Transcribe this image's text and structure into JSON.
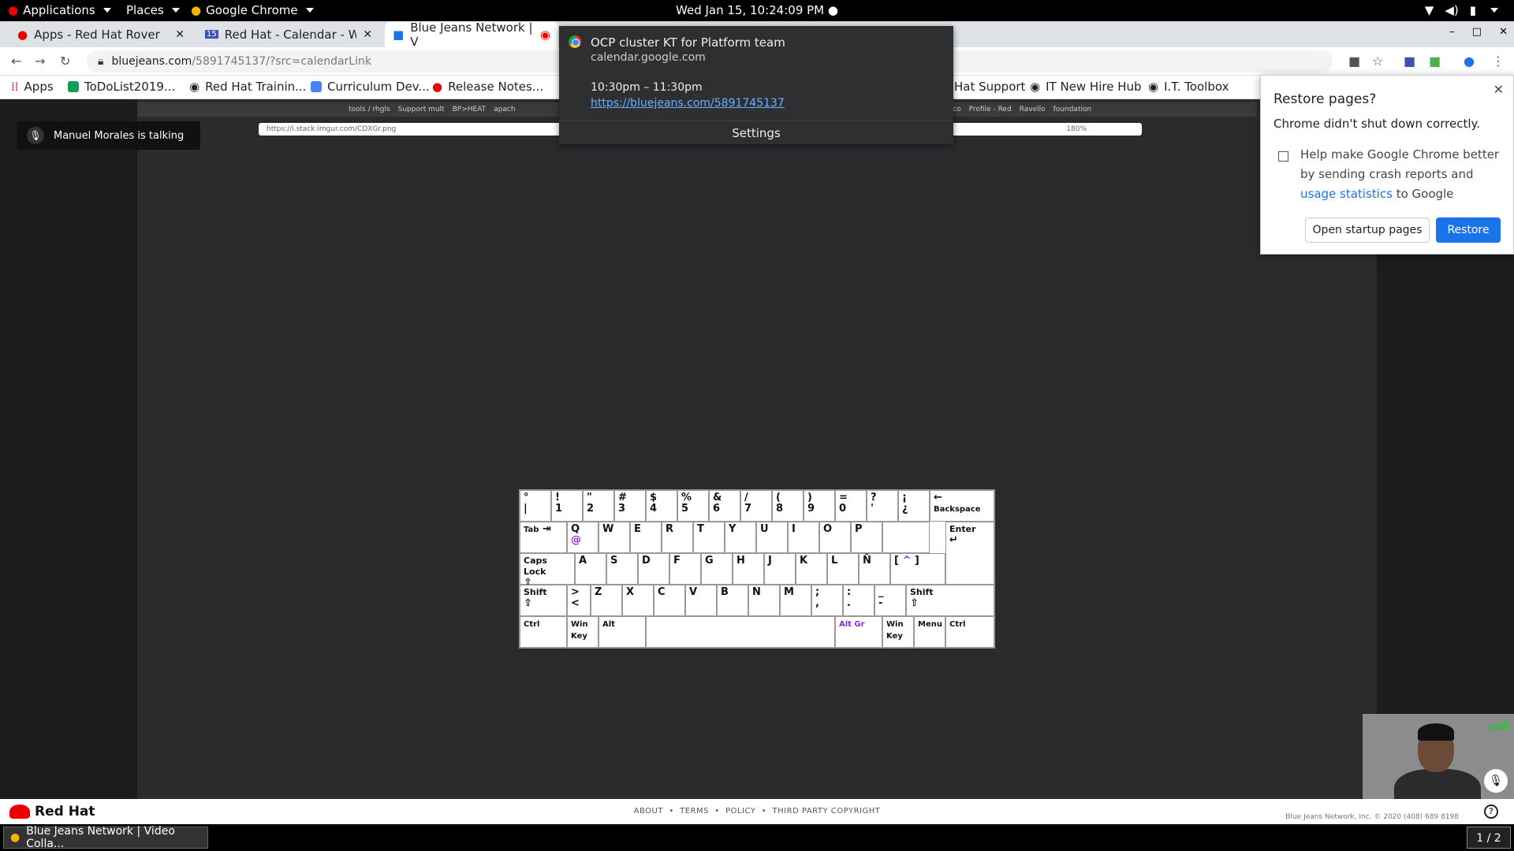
{
  "topbar": {
    "applications": "Applications",
    "places": "Places",
    "chrome": "Google Chrome",
    "clock": "Wed Jan 15, 10:24:09 PM"
  },
  "tabs": [
    {
      "label": "Apps - Red Hat Rover"
    },
    {
      "label": "Red Hat - Calendar - Week"
    },
    {
      "label": "Blue Jeans Network | V"
    }
  ],
  "address": {
    "host": "bluejeans.com",
    "path": "/5891745137/?src=calendarLink"
  },
  "bookmarks": [
    "Apps",
    "ToDoList2019...",
    "Red Hat Trainin...",
    "Curriculum Dev...",
    "Release Notes...",
    "Hat Support",
    "IT New Hire Hub",
    "I.T. Toolbox"
  ],
  "inner": {
    "tabs": [
      "tools / rhgls",
      "Support mult",
      "BP>HEAT",
      "apach",
      "Providing co",
      "Profile - Red",
      "Ravello",
      "foundation"
    ],
    "url": "https://i.stack.imgur.com/CDXGr.png",
    "zoom": "180%"
  },
  "talking": "Manuel Morales is talking",
  "notification": {
    "title": "OCP cluster KT for Platform team",
    "source": "calendar.google.com",
    "time": "10:30pm – 11:30pm",
    "link": "https://bluejeans.com/5891745137",
    "settings": "Settings"
  },
  "restore": {
    "title": "Restore pages?",
    "message": "Chrome didn't shut down correctly.",
    "help_pre": "Help make Google Chrome better by sending crash reports and",
    "help_link": "usage statistics",
    "help_post": "to Google",
    "open_btn": "Open startup pages",
    "restore_btn": "Restore"
  },
  "footer": {
    "brand": "Red Hat",
    "links": [
      "ABOUT",
      "TERMS",
      "POLICY",
      "THIRD PARTY COPYRIGHT"
    ],
    "legal": "Blue Jeans Network, Inc. © 2020     (408) 689 8198"
  },
  "taskbar": {
    "window": "Blue Jeans Network | Video Colla...",
    "pager": "1 / 2"
  },
  "keyboard": {
    "row1": [
      [
        "°",
        "|"
      ],
      [
        "!",
        "1"
      ],
      [
        "\"",
        "2"
      ],
      [
        "#",
        "3"
      ],
      [
        "$",
        "4"
      ],
      [
        "%",
        "5"
      ],
      [
        "&",
        "6"
      ],
      [
        "/",
        "7"
      ],
      [
        "(",
        "8"
      ],
      [
        ")",
        "9"
      ],
      [
        "=",
        "0"
      ],
      [
        "?",
        "'"
      ],
      [
        "¡",
        "¿"
      ]
    ],
    "backspace": "Backspace",
    "tab": "Tab",
    "row2": [
      "Q",
      "W",
      "E",
      "R",
      "T",
      "Y",
      "U",
      "I",
      "O",
      "P"
    ],
    "at": "@",
    "enter": "Enter",
    "caps": "Caps Lock",
    "row3": [
      "A",
      "S",
      "D",
      "F",
      "G",
      "H",
      "J",
      "K",
      "L",
      "Ñ"
    ],
    "shift": "Shift",
    "row4": [
      "Z",
      "X",
      "C",
      "V",
      "B",
      "N",
      "M"
    ],
    "bottom": [
      "Ctrl",
      "Win Key",
      "Alt",
      "Alt Gr",
      "Win Key",
      "Menu",
      "Ctrl"
    ]
  }
}
